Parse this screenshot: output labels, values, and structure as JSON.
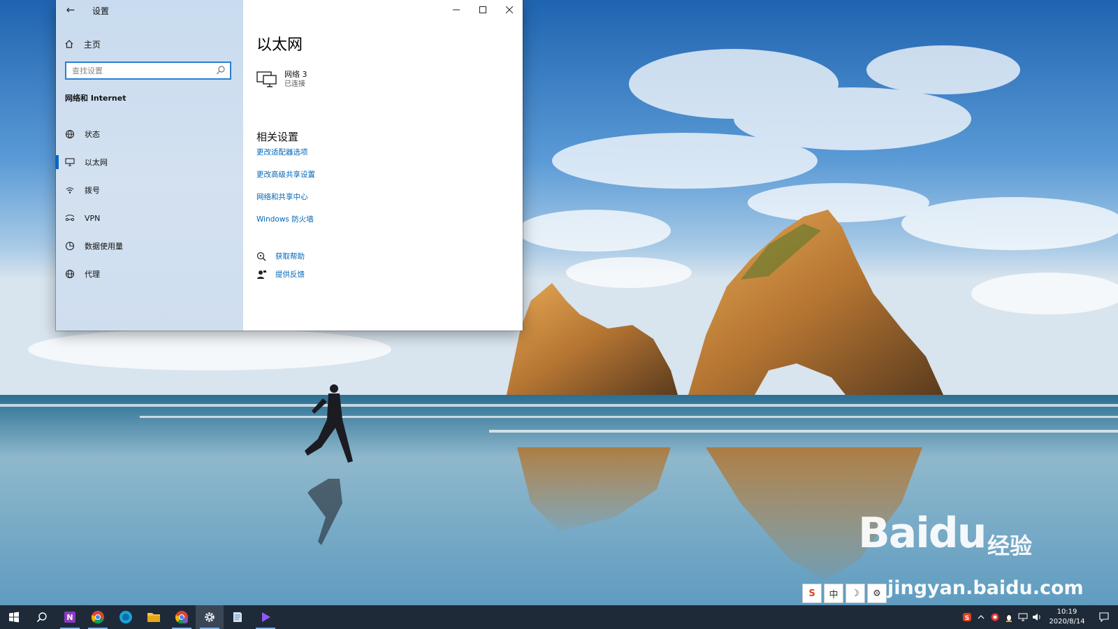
{
  "window": {
    "title": "设置",
    "home_label": "主页",
    "search_placeholder": "查找设置",
    "section_title": "网络和 Internet",
    "nav_items": [
      {
        "label": "状态",
        "icon": "status-globe-icon"
      },
      {
        "label": "以太网",
        "icon": "ethernet-monitor-icon",
        "active": true
      },
      {
        "label": "拨号",
        "icon": "dialup-icon"
      },
      {
        "label": "VPN",
        "icon": "vpn-icon"
      },
      {
        "label": "数据使用量",
        "icon": "data-usage-icon"
      },
      {
        "label": "代理",
        "icon": "proxy-globe-icon"
      }
    ]
  },
  "content": {
    "title": "以太网",
    "network": {
      "name": "网络 3",
      "status": "已连接"
    },
    "related_title": "相关设置",
    "links": [
      "更改适配器选项",
      "更改高级共享设置",
      "网络和共享中心",
      "Windows 防火墙"
    ],
    "help": {
      "get_help": "获取帮助",
      "feedback": "提供反馈"
    }
  },
  "watermark": {
    "brand": "Baidu",
    "suffix": "经验",
    "url": "jingyan.baidu.com"
  },
  "ime": {
    "items": [
      "S",
      "中",
      "☽",
      "⚙"
    ]
  },
  "taskbar": {
    "apps": [
      "start-icon",
      "search-icon",
      "onenote-icon",
      "chrome-icon",
      "edge-icon",
      "file-explorer-icon",
      "chrome-profile-icon",
      "settings-gear-icon",
      "notepad-icon",
      "media-player-icon"
    ],
    "clock": {
      "time": "10:19",
      "date": "2020/8/14"
    }
  },
  "colors": {
    "accent": "#0067b8",
    "sidebar_bg": "#cfdeef",
    "taskbar_bg": "#1f2a38",
    "active_marker": "#0a64c8"
  }
}
